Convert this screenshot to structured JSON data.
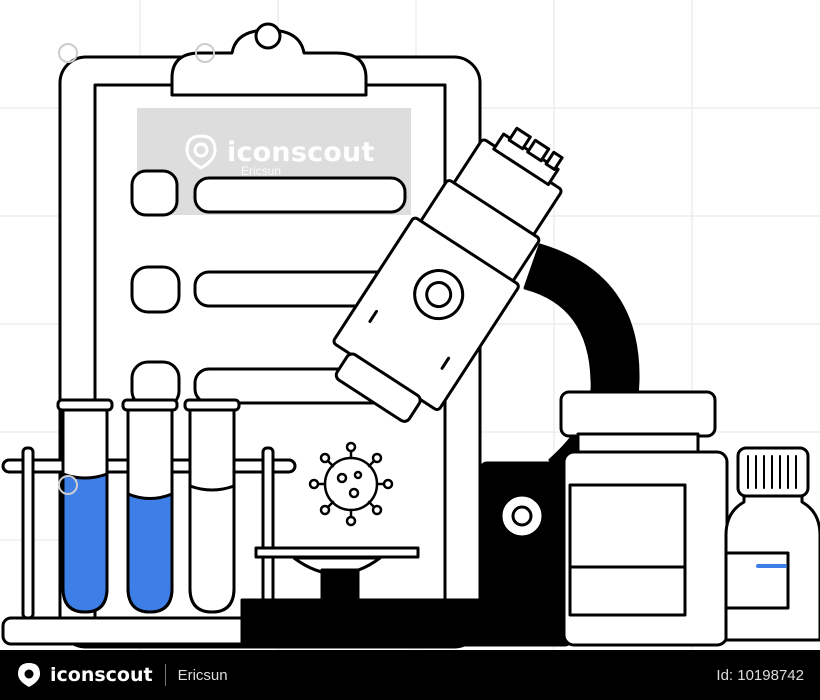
{
  "watermark": {
    "brand": "iconscout",
    "author": "Ericsun",
    "logo_icon": "iconscout-logo-icon"
  },
  "footer": {
    "brand": "iconscout",
    "author": "Ericsun",
    "asset_id": "Id: 10198742",
    "logo_icon": "iconscout-logo-icon"
  },
  "illustration": {
    "subject": "laboratory-clipboard-microscope-test-tubes",
    "colors": {
      "outline": "#000000",
      "fill": "#ffffff",
      "liquid": "#3d7fe6",
      "watermark_box": "#dddddd",
      "footer_bg": "#000000"
    }
  }
}
